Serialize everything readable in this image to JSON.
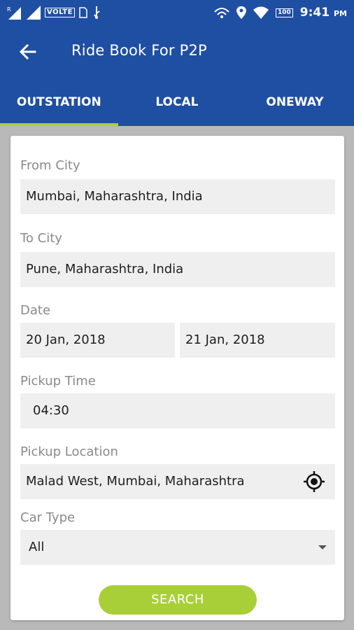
{
  "status_bar": {
    "network": "VOLTE",
    "battery": "100",
    "time": "9:41",
    "ampm": "PM"
  },
  "app_bar": {
    "title": "Ride Book For P2P"
  },
  "tabs": [
    {
      "label": "OUTSTATION",
      "active": true
    },
    {
      "label": "LOCAL",
      "active": false
    },
    {
      "label": "ONEWAY",
      "active": false
    }
  ],
  "form": {
    "from_city": {
      "label": "From City",
      "value": "Mumbai, Maharashtra, India"
    },
    "to_city": {
      "label": "To City",
      "value": "Pune, Maharashtra, India"
    },
    "date": {
      "label": "Date",
      "start": "20 Jan, 2018",
      "end": "21 Jan, 2018"
    },
    "pickup_time": {
      "label": "Pickup Time",
      "value": "04:30"
    },
    "pickup_location": {
      "label": "Pickup Location",
      "value": "Malad West, Mumbai, Maharashtra"
    },
    "car_type": {
      "label": "Car Type",
      "value": "All"
    },
    "search_label": "SEARCH"
  },
  "colors": {
    "primary": "#1f4fa3",
    "accent": "#a9cf38",
    "field_bg": "#efefef"
  },
  "icons": {
    "back": "arrow-left-icon",
    "location": "gps-target-icon",
    "dropdown": "caret-down-icon"
  }
}
